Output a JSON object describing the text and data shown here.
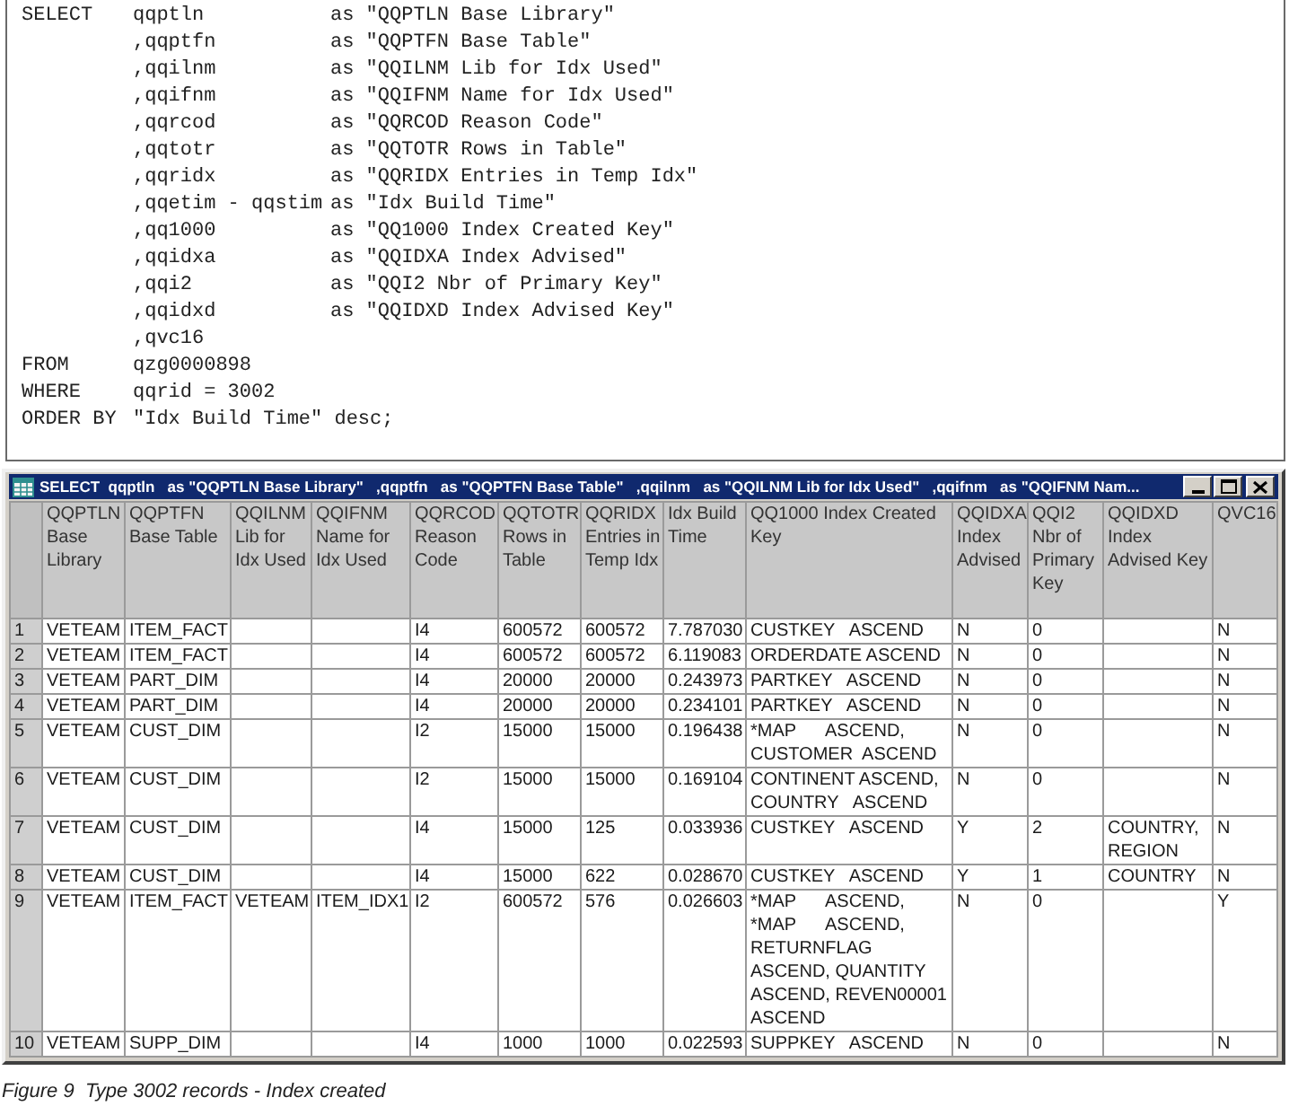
{
  "query": {
    "lines": [
      {
        "keyword": "SELECT",
        "column": "qqptln",
        "alias": "as \"QQPTLN Base Library\""
      },
      {
        "column": ",qqptfn",
        "alias": "as \"QQPTFN Base Table\""
      },
      {
        "column": ",qqilnm",
        "alias": "as \"QQILNM Lib for Idx Used\""
      },
      {
        "column": ",qqifnm",
        "alias": "as \"QQIFNM Name for Idx Used\""
      },
      {
        "column": ",qqrcod",
        "alias": "as \"QQRCOD Reason Code\""
      },
      {
        "column": ",qqtotr",
        "alias": "as \"QQTOTR Rows in Table\""
      },
      {
        "column": ",qqridx",
        "alias": "as \"QQRIDX Entries in Temp Idx\""
      },
      {
        "column": ",qqetim - qqstim",
        "alias": "as \"Idx Build Time\""
      },
      {
        "column": ",qq1000",
        "alias": "as \"QQ1000 Index Created Key\""
      },
      {
        "column": ",qqidxa",
        "alias": "as \"QQIDXA Index Advised\""
      },
      {
        "column": ",qqi2",
        "alias": "as \"QQI2 Nbr of Primary Key\""
      },
      {
        "column": ",qqidxd",
        "alias": "as \"QQIDXD Index Advised Key\""
      },
      {
        "column": ",qvc16"
      },
      {
        "keyword": "FROM",
        "column": "qzg0000898"
      },
      {
        "keyword": "WHERE",
        "column": "qqrid = 3002"
      },
      {
        "keyword": "ORDER BY",
        "column": "\"Idx Build Time\" desc;"
      }
    ]
  },
  "window": {
    "title": "SELECT  qqptln   as \"QQPTLN Base Library\"   ,qqptfn   as \"QQPTFN Base Table\"   ,qqilnm   as \"QQILNM Lib for Idx Used\"   ,qqifnm   as \"QQIFNM Nam...",
    "columns": [
      "QQPTLN Base Library",
      "QQPTFN Base Table",
      "QQILNM Lib for Idx Used",
      "QQIFNM Name for Idx Used",
      "QQRCOD Reason Code",
      "QQTOTR Rows in Table",
      "QQRIDX Entries in Temp Idx",
      "Idx Build Time",
      "QQ1000 Index Created Key",
      "QQIDXA Index Advised",
      "QQI2 Nbr of Primary Key",
      "QQIDXD Index Advised Key",
      "QVC16"
    ],
    "rows": [
      {
        "number": "1",
        "cells": [
          "VETEAM",
          "ITEM_FACT",
          null,
          null,
          "I4",
          "600572",
          "600572",
          "7.787030",
          "CUSTKEY   ASCEND",
          "N",
          "0",
          null,
          "N"
        ]
      },
      {
        "number": "2",
        "cells": [
          "VETEAM",
          "ITEM_FACT",
          null,
          null,
          "I4",
          "600572",
          "600572",
          "6.119083",
          "ORDERDATE ASCEND",
          "N",
          "0",
          null,
          "N"
        ]
      },
      {
        "number": "3",
        "cells": [
          "VETEAM",
          "PART_DIM",
          null,
          null,
          "I4",
          "20000",
          "20000",
          "0.243973",
          "PARTKEY   ASCEND",
          "N",
          "0",
          null,
          "N"
        ]
      },
      {
        "number": "4",
        "cells": [
          "VETEAM",
          "PART_DIM",
          null,
          null,
          "I4",
          "20000",
          "20000",
          "0.234101",
          "PARTKEY   ASCEND",
          "N",
          "0",
          null,
          "N"
        ]
      },
      {
        "number": "5",
        "cells": [
          "VETEAM",
          "CUST_DIM",
          null,
          null,
          "I2",
          "15000",
          "15000",
          "0.196438",
          "*MAP      ASCEND, CUSTOMER  ASCEND",
          "N",
          "0",
          null,
          "N"
        ]
      },
      {
        "number": "6",
        "cells": [
          "VETEAM",
          "CUST_DIM",
          null,
          null,
          "I2",
          "15000",
          "15000",
          "0.169104",
          "CONTINENT ASCEND, COUNTRY   ASCEND",
          "N",
          "0",
          null,
          "N"
        ]
      },
      {
        "number": "7",
        "cells": [
          "VETEAM",
          "CUST_DIM",
          null,
          null,
          "I4",
          "15000",
          "125",
          "0.033936",
          "CUSTKEY   ASCEND",
          "Y",
          "2",
          "COUNTRY, REGION",
          "N"
        ]
      },
      {
        "number": "8",
        "cells": [
          "VETEAM",
          "CUST_DIM",
          null,
          null,
          "I4",
          "15000",
          "622",
          "0.028670",
          "CUSTKEY   ASCEND",
          "Y",
          "1",
          "COUNTRY",
          "N"
        ]
      },
      {
        "number": "9",
        "cells": [
          "VETEAM",
          "ITEM_FACT",
          "VETEAM",
          "ITEM_IDX1",
          "I2",
          "600572",
          "576",
          "0.026603",
          "*MAP      ASCEND, *MAP      ASCEND, RETURNFLAG ASCEND, QUANTITY  ASCEND, REVEN00001 ASCEND",
          "N",
          "0",
          null,
          "Y"
        ]
      },
      {
        "number": "10",
        "cells": [
          "VETEAM",
          "SUPP_DIM",
          null,
          null,
          "I4",
          "1000",
          "1000",
          "0.022593",
          "SUPPKEY   ASCEND",
          "N",
          "0",
          null,
          "N"
        ]
      }
    ]
  },
  "caption": "Figure 9  Type 3002 records - Index created"
}
